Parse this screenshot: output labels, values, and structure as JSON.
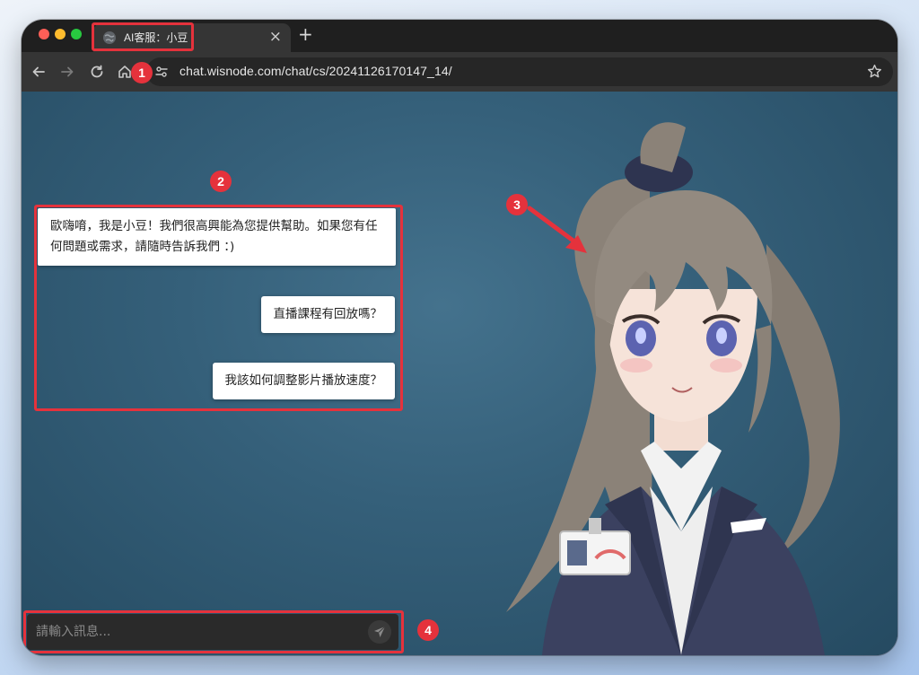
{
  "browser": {
    "tab": {
      "title": "AI客服：小豆",
      "close_glyph": "×"
    },
    "new_tab_glyph": "+",
    "url": "chat.wisnode.com/chat/cs/20241126170147_14/"
  },
  "chat": {
    "messages": [
      {
        "role": "bot",
        "text": "歐嗨唷，我是小豆！我們很高興能為您提供幫助。如果您有任何問題或需求，請隨時告訴我們 ：)"
      },
      {
        "role": "user",
        "text": "直播課程有回放嗎？"
      },
      {
        "role": "user",
        "text": "我該如何調整影片播放速度？"
      }
    ],
    "input": {
      "placeholder": "請輸入訊息..."
    },
    "send_icon": "paper-plane-icon"
  },
  "annotations": {
    "color": "#e5323c",
    "badges": [
      "1",
      "2",
      "3",
      "4"
    ]
  },
  "colors": {
    "window_chrome": "#1f1f1f",
    "toolbar": "#353535",
    "viewport_bg": "#35607a",
    "highlight": "#e5323c"
  }
}
